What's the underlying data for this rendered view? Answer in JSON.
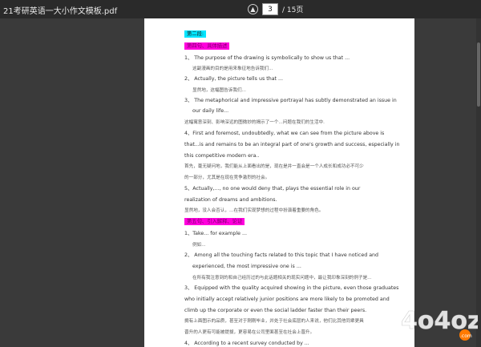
{
  "window": {
    "filename": "21考研英语一大小作文模板.pdf"
  },
  "pager": {
    "current_page": "3",
    "total_label": "/ 15页"
  },
  "doc": {
    "h_section": "第二段:",
    "h_sub1": "第四句、具体描述",
    "l1": "1、 The purpose of the drawing is symbolically to show us that ...",
    "l1c": "这副漫画的目的是用来象征地告诉我们...",
    "l2": "2、 Actually, the picture tells us that ...",
    "l2c": "显然地，这幅图告诉我们...",
    "l3": "3、  The metaphorical and impressive portrayal has subtly demonstrated an issue in",
    "l3b": "our daily life...",
    "l3c": "这幅寓意深刻、影响深远的图微妙的揭示了一个...问题在我们的生活中.",
    "l4": "4、First and foremost, undoubtedly, what we can see from the picture above is",
    "l4b": "that...is and remains to be an integral part of one's growth and success, especially in",
    "l4c": "this competitive modern era..",
    "l4d": "首先，毫无疑问地，我们能从上面看出的是，现在是并一直会是一个人成长和成功必不可少",
    "l4e": "的一部分，尤其是在现在竞争激烈的社会。",
    "l5": "5、Actually,..., no one would deny that, plays the essential role in our",
    "l5b": "realization of dreams and ambitions.",
    "l5c": "显然地，没人会否认，…在我们实现梦想的过程中扮演着重要的角色。",
    "h_sub2": "第五句、引入解释、论证",
    "m1": "1、Take... for example ...",
    "m1c": "例如...",
    "m2": "2、 Among all the touching facts related to this topic that I have noticed and",
    "m2b": "experienced, the most impressive one is ...",
    "m2c": "在所有我注意到的和自己经历过的与此话题相关的现实问题中，最让我印象深刻的例子是...",
    "m3": "3、 Equipped with the quality acquired showing in the picture, even those graduates",
    "m3b": "who initially accept relatively junior positions are more likely to be promoted and",
    "m3c": "climb up the corporate or even the social ladder faster than their peers.",
    "m3d": "拥有上面图示的品质，甚至对于刚刚毕业，并处于社会底层的人来说，他们比其他同辈更具",
    "m3e": "晋升的人更有可能被提拔，更容易在公司里面甚至在社会上晋升。",
    "m4": "4、 According to a recent survey conducted by ..."
  },
  "watermark": {
    "text": "4o4oz",
    "text_suffix": ".com"
  }
}
